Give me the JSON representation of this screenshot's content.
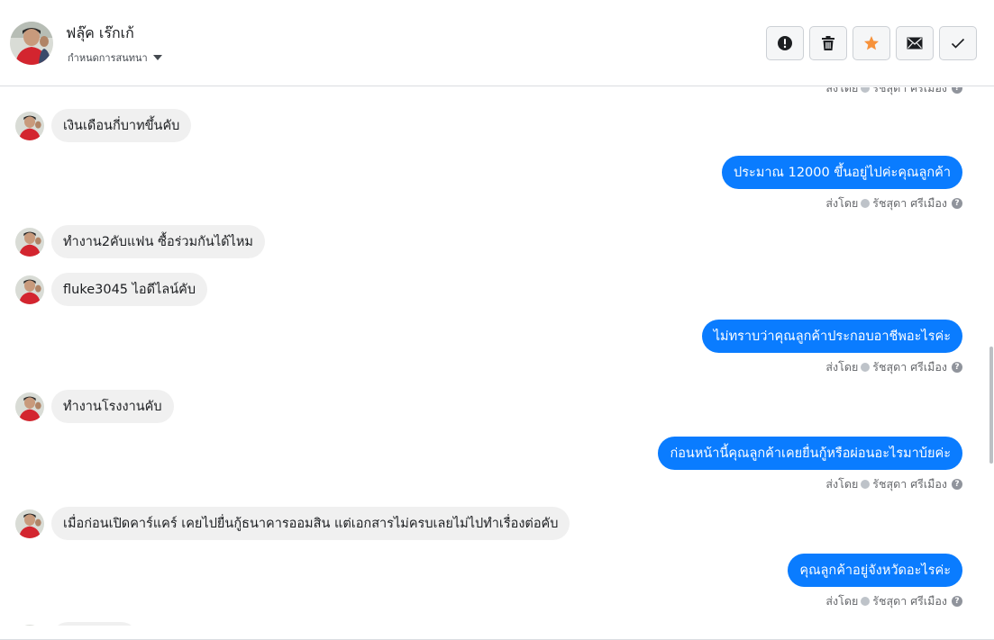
{
  "header": {
    "contact_name": "ฟลุ๊ค เร๊กเก้",
    "conversation_settings": "กำหนดการสนทนา"
  },
  "toolbar": {
    "buttons": [
      {
        "icon": "exclamation-icon",
        "color": "#1c1e21"
      },
      {
        "icon": "trash-icon",
        "color": "#1c1e21"
      },
      {
        "icon": "star-icon",
        "color": "#f7923b"
      },
      {
        "icon": "envelope-icon",
        "color": "#1c1e21"
      },
      {
        "icon": "checkmark-icon",
        "color": "#1c1e21"
      }
    ]
  },
  "thread": {
    "sent_by_prefix": "ส่งโดย",
    "agent_name": "รัชสุดา ศรีเมือง",
    "messages": [
      {
        "direction": "in",
        "text": "เงินเดือนกี่บาทขึ้นคับ"
      },
      {
        "direction": "out",
        "text": "ประมาณ 12000  ขึ้นอยู่ไปค่ะคุณลูกค้า"
      },
      {
        "direction": "in",
        "text": "ทำงาน2คับแฟน ซื้อร่วมกันได้ไหม"
      },
      {
        "direction": "in",
        "text": "fluke3045 ไอดีไลน์คับ"
      },
      {
        "direction": "out",
        "text": "ไม่ทราบว่าคุณลูกค้าประกอบอาชีพอะไรค่ะ"
      },
      {
        "direction": "in",
        "text": "ทำงานโรงงานคับ"
      },
      {
        "direction": "out",
        "text": "ก่อนหน้านี้คุณลูกค้าเคยยื่นกู้หรือผ่อนอะไรมาบ้ยค่ะ"
      },
      {
        "direction": "in",
        "text": "เมื่อก่อนเปิดคาร์แคร์ เคยไปยื่นกู้ธนาคารออมสิน แต่เอกสารไม่ครบเลยไม่ไปทำเรื่องต่อคับ"
      },
      {
        "direction": "out",
        "text": "คุณลูกค้าอยู่จังหวัดอะไรค่ะ"
      }
    ]
  },
  "colors": {
    "outgoing_bubble": "#0a7cff",
    "incoming_bubble": "#f0f0f0",
    "star": "#f7923b"
  }
}
